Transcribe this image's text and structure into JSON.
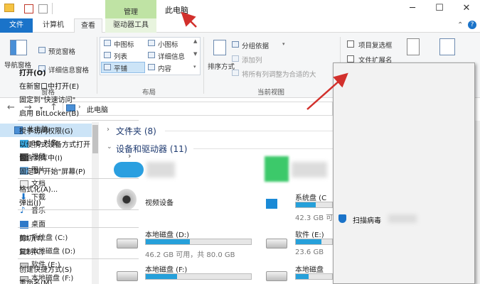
{
  "window": {
    "context_tab": "管理",
    "title": "此电脑",
    "min_icon": "minimize-icon",
    "max_icon": "maximize-icon",
    "close_icon": "close-icon"
  },
  "tabs": [
    "文件",
    "计算机",
    "查看",
    "驱动器工具"
  ],
  "ribbon": {
    "pane_group": {
      "nav_pane": "导航窗格",
      "preview_pane": "预览窗格",
      "details_pane": "详细信息窗格",
      "label": "窗格"
    },
    "layout_group": {
      "items": [
        "中图标",
        "小图标",
        "列表",
        "详细信息",
        "平铺",
        "内容"
      ],
      "label": "布局"
    },
    "view_group": {
      "sort": "排序方式",
      "group_by": "分组依据",
      "add_column": "添加列",
      "fit_columns": "将所有列调整为合适的大",
      "label": "当前视图"
    },
    "show_group": {
      "item_checkbox": "项目复选框",
      "file_ext": "文件扩展名"
    }
  },
  "address": {
    "path": "此电脑"
  },
  "nav_items": [
    {
      "label": "此电脑",
      "icon": "pc-icon"
    },
    {
      "label": "3D 对象",
      "icon": "3d-objects-icon"
    },
    {
      "label": "视频",
      "icon": "video-folder-icon"
    },
    {
      "label": "图片",
      "icon": "pictures-folder-icon"
    },
    {
      "label": "文档",
      "icon": "documents-folder-icon"
    },
    {
      "label": "下载",
      "icon": "downloads-folder-icon"
    },
    {
      "label": "音乐",
      "icon": "music-folder-icon"
    },
    {
      "label": "桌面",
      "icon": "desktop-folder-icon"
    },
    {
      "label": "系统盘 (C:)",
      "icon": "drive-icon"
    },
    {
      "label": "本地磁盘 (D:)",
      "icon": "drive-icon"
    },
    {
      "label": "软件 (E:)",
      "icon": "drive-icon"
    },
    {
      "label": "本地磁盘 (F:)",
      "icon": "drive-icon"
    }
  ],
  "content": {
    "folders_header": "文件夹 (8)",
    "devices_header": "设备和驱动器 (11)",
    "devices": [
      {
        "name": "视频设备",
        "free": ""
      },
      {
        "name": "本地磁盘 (D:)",
        "free": "46.2 GB 可用，共 80.0 GB",
        "used_fraction": 0.42
      },
      {
        "name": "本地磁盘 (F:)",
        "free": "",
        "used_fraction": 0.3
      },
      {
        "name": "系统盘 (C",
        "free": "42.3 GB 可",
        "used_fraction": 0.55
      },
      {
        "name": "软件 (E:)",
        "free": "23.6 GB",
        "used_fraction": 0.7
      },
      {
        "name": "本地磁盘",
        "free": "",
        "used_fraction": 0.35
      }
    ]
  },
  "context_menu": {
    "items": [
      {
        "label": "打开(O)",
        "bold": true
      },
      {
        "label": "在新窗口中打开(E)"
      },
      {
        "label": "固定到\"快速访问\""
      },
      {
        "label": "启用 BitLocker(B)"
      },
      {
        "label": "授予访问权限(G)",
        "submenu": true
      },
      {
        "label": "以便携式设备方式打开"
      },
      {
        "label": "包含到库中(I)",
        "submenu": true
      },
      {
        "label": "固定到\"开始\"屏幕(P)"
      },
      {
        "label": "格式化(A)..."
      },
      {
        "label": "弹出(J)"
      },
      {
        "label": "扫描病毒"
      },
      {
        "label": "剪切(T)"
      },
      {
        "label": "复制(C)"
      },
      {
        "label": "创建快捷方式(S)"
      },
      {
        "label": "重命名(M)"
      }
    ]
  },
  "colors": {
    "accent": "#1a73c9",
    "annotation": "#d2302c",
    "drive_fill": "#26a0da"
  }
}
